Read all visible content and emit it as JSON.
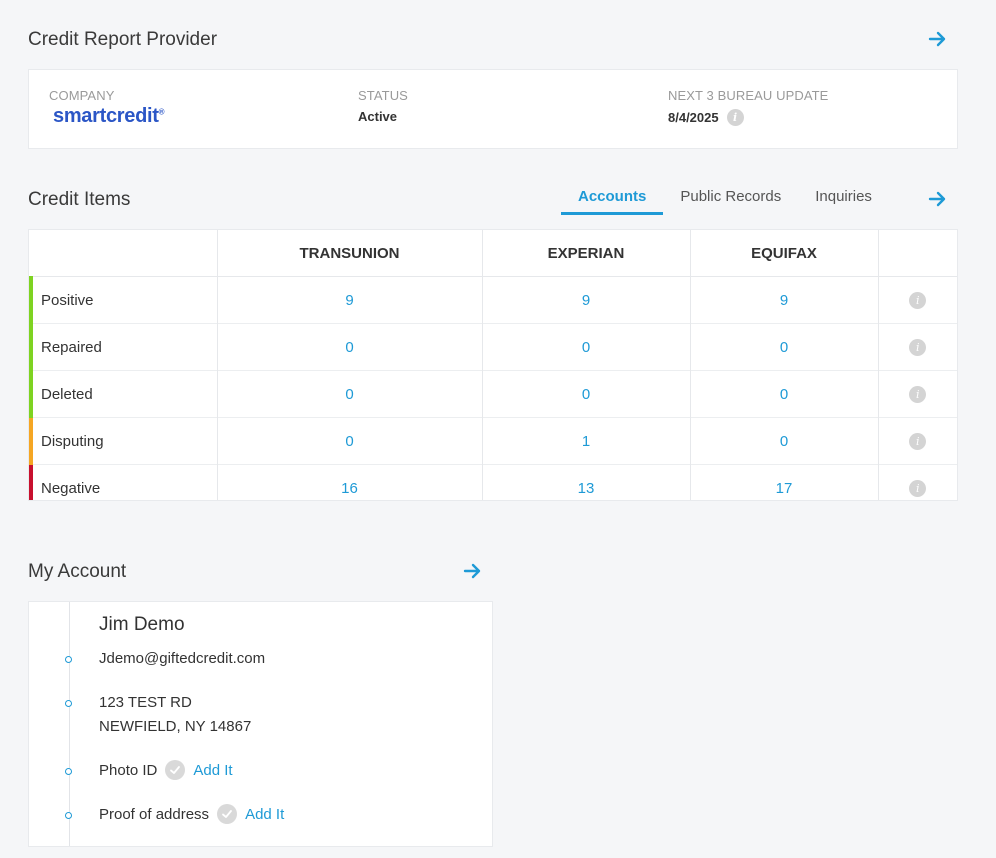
{
  "provider": {
    "title": "Credit Report Provider",
    "company_label": "COMPANY",
    "company_logo": "smartcredit",
    "company_logo_mark": "®",
    "status_label": "STATUS",
    "status_value": "Active",
    "update_label": "NEXT 3 BUREAU UPDATE",
    "update_value": "8/4/2025"
  },
  "credit_items": {
    "title": "Credit Items",
    "tabs": [
      {
        "label": "Accounts",
        "active": true
      },
      {
        "label": "Public Records",
        "active": false
      },
      {
        "label": "Inquiries",
        "active": false
      }
    ],
    "columns": [
      "",
      "TRANSUNION",
      "EXPERIAN",
      "EQUIFAX",
      ""
    ],
    "rows": [
      {
        "label": "Positive",
        "color": "#7ed321",
        "values": [
          "9",
          "9",
          "9"
        ]
      },
      {
        "label": "Repaired",
        "color": "#7ed321",
        "values": [
          "0",
          "0",
          "0"
        ]
      },
      {
        "label": "Deleted",
        "color": "#7ed321",
        "values": [
          "0",
          "0",
          "0"
        ]
      },
      {
        "label": "Disputing",
        "color": "#f5a623",
        "values": [
          "0",
          "1",
          "0"
        ]
      },
      {
        "label": "Negative",
        "color": "#c8102e",
        "values": [
          "16",
          "13",
          "17"
        ]
      }
    ]
  },
  "account": {
    "title": "My Account",
    "name": "Jim Demo",
    "email": "Jdemo@giftedcredit.com",
    "address_line1": "123 TEST RD",
    "address_line2": "NEWFIELD, NY 14867",
    "photo_id_label": "Photo ID",
    "photo_id_action": "Add It",
    "proof_label": "Proof of address",
    "proof_action": "Add It"
  },
  "colors": {
    "accent": "#1e9ad6",
    "positive": "#7ed321",
    "disputing": "#f5a623",
    "negative": "#c8102e"
  },
  "icons": {
    "nav": "arrow-right-icon",
    "info": "info-icon",
    "check": "check-circle-icon"
  }
}
